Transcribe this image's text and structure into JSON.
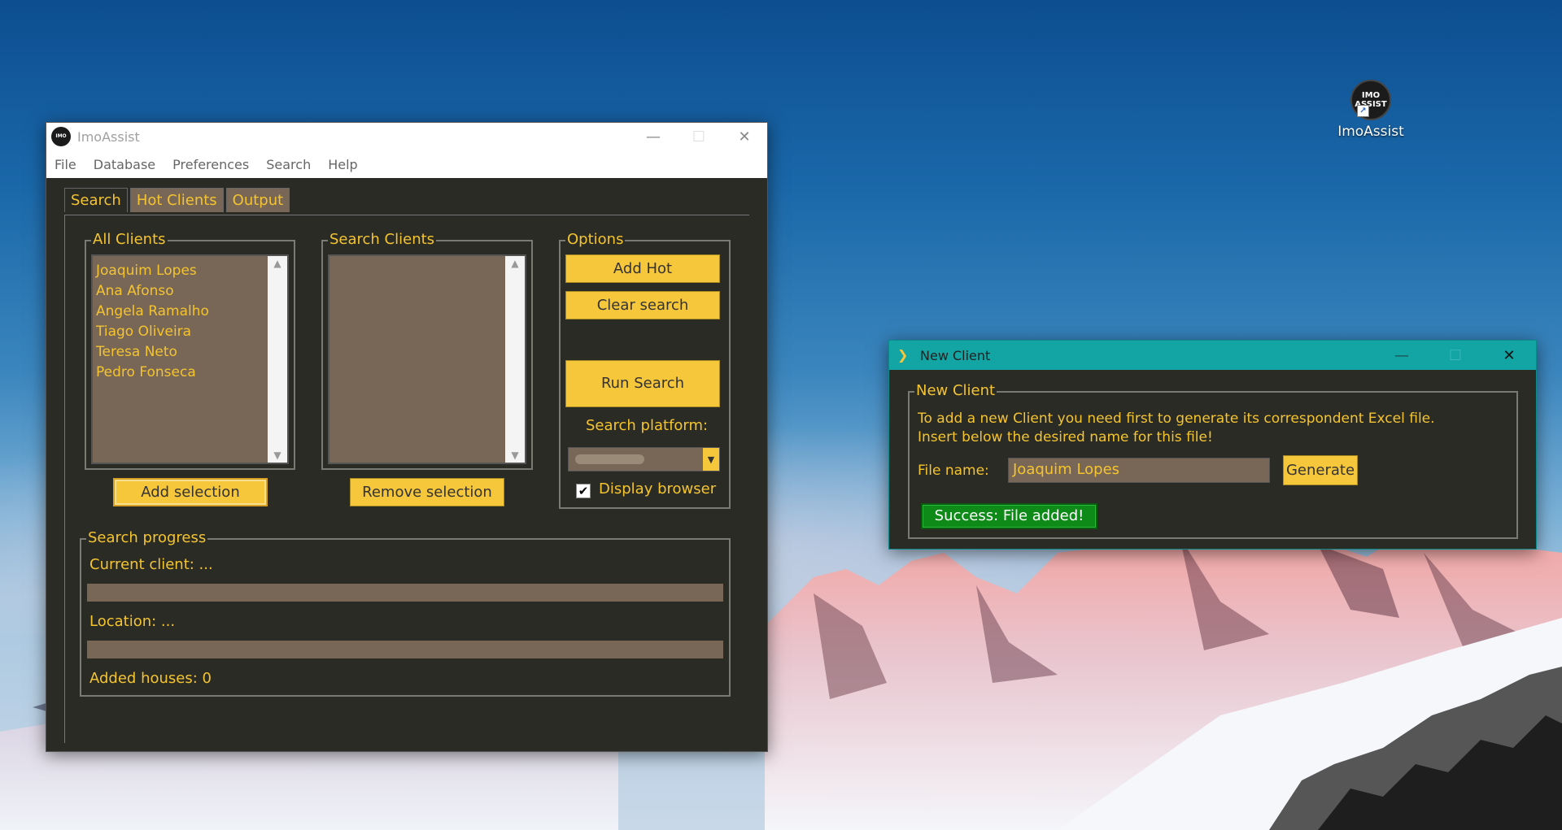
{
  "desktop": {
    "icon_label": "ImoAssist",
    "icon_logo_text": "IMO ASSIST"
  },
  "main_window": {
    "title": "ImoAssist",
    "logo_text": "IMO",
    "controls": {
      "minimize": "—",
      "maximize": "☐",
      "close": "✕"
    },
    "menu": [
      "File",
      "Database",
      "Preferences",
      "Search",
      "Help"
    ],
    "tabs": [
      {
        "label": "Search",
        "active": true
      },
      {
        "label": "Hot Clients",
        "active": false
      },
      {
        "label": "Output",
        "active": false
      }
    ],
    "all_clients": {
      "label": "All Clients",
      "items": [
        "Joaquim Lopes",
        "Ana Afonso",
        "Angela Ramalho",
        "Tiago Oliveira",
        "Teresa Neto",
        "Pedro Fonseca"
      ],
      "button": "Add selection"
    },
    "search_clients": {
      "label": "Search Clients",
      "items": [],
      "button": "Remove selection"
    },
    "options": {
      "label": "Options",
      "add_hot": "Add Hot",
      "clear_search": "Clear search",
      "run_search": "Run Search",
      "platform_label": "Search platform:",
      "display_browser_label": "Display browser",
      "display_browser_checked": true
    },
    "progress": {
      "label": "Search progress",
      "current_client": "Current client: ...",
      "current_client_progress": 0,
      "location": "Location: ...",
      "location_progress": 0,
      "added_houses": "Added houses: 0"
    }
  },
  "new_client_window": {
    "title": "New Client",
    "controls": {
      "minimize": "—",
      "maximize": "☐",
      "close": "✕"
    },
    "group_label": "New Client",
    "instructions_line1": "To add a new Client you need first to generate its correspondent Excel file.",
    "instructions_line2": "Insert below the desired name for this file!",
    "file_name_label": "File name:",
    "file_name_value": "Joaquim Lopes",
    "generate_button": "Generate",
    "status": "Success: File added!"
  },
  "colors": {
    "accent": "#f4c430",
    "button": "#f6c73a",
    "panel": "#2b2b26",
    "field": "#786656",
    "titlebar_new": "#13a4a4",
    "success": "#0d8a17"
  }
}
